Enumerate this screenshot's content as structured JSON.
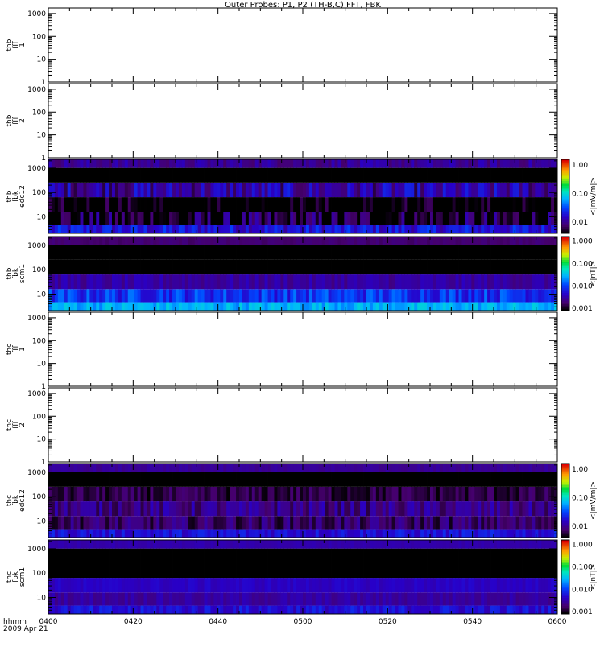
{
  "title": "Outer Probes: P1, P2 (TH-B,C) FFT, FBK",
  "x_axis": {
    "label": "hhmm",
    "date": "2009 Apr 21",
    "ticks": [
      "0400",
      "0420",
      "0440",
      "0500",
      "0520",
      "0540",
      "0600"
    ]
  },
  "chart_data": {
    "type": "heatmap",
    "title": "Outer Probes: P1, P2 (TH-B,C) FFT, FBK",
    "xlabel": "hhmm",
    "xrange_hhmm": [
      "0400",
      "0600"
    ],
    "panels": [
      {
        "label": [
          "thb",
          "fff",
          "1"
        ],
        "kind": "empty",
        "yticks": [
          "1",
          "10",
          "100",
          "1000"
        ],
        "ylim": [
          1,
          1750
        ]
      },
      {
        "label": [
          "thb",
          "fff",
          "2"
        ],
        "kind": "empty",
        "yticks": [
          "1",
          "10",
          "100",
          "1000"
        ],
        "ylim": [
          1,
          1750
        ]
      },
      {
        "label": [
          "thb",
          "fbk",
          "edc12"
        ],
        "kind": "spectrogram",
        "yticks": [
          "10",
          "100",
          "1000"
        ],
        "ylim": [
          2.1,
          2300
        ],
        "band_freqs_hz": [
          2.7,
          8,
          32,
          128,
          512,
          2048
        ],
        "band_median_log10": [
          -1.75,
          -2.35,
          -2.6,
          -1.95,
          -3.0,
          -2.0
        ],
        "band_spread": [
          0.25,
          0.45,
          0.45,
          0.3,
          0.35,
          0.15
        ],
        "colorbar": {
          "ticks": [
            "1.00",
            "0.10",
            "0.01"
          ],
          "unit": "<|mV/m|>",
          "range_log10": [
            -2.4,
            0.2
          ]
        }
      },
      {
        "label": [
          "thb",
          "fbk",
          "scm1"
        ],
        "kind": "spectrogram",
        "yticks": [
          "10",
          "100",
          "1000"
        ],
        "ylim": [
          2.1,
          2300
        ],
        "band_freqs_hz": [
          2.7,
          8,
          32,
          128,
          512,
          2048
        ],
        "band_median_log10": [
          -1.55,
          -2.05,
          -2.55,
          -3.2,
          -3.2,
          -2.75
        ],
        "band_spread": [
          0.2,
          0.3,
          0.15,
          0.08,
          0.08,
          0.06
        ],
        "colorbar": {
          "ticks": [
            "1.000",
            "0.100",
            "0.010",
            "0.001"
          ],
          "unit": "<|nT|>",
          "range_log10": [
            -3.1,
            0.2
          ]
        }
      },
      {
        "label": [
          "thc",
          "fff",
          "1"
        ],
        "kind": "empty",
        "yticks": [
          "1",
          "10",
          "100",
          "1000"
        ],
        "ylim": [
          1,
          1750
        ]
      },
      {
        "label": [
          "thc",
          "fff",
          "2"
        ],
        "kind": "empty",
        "yticks": [
          "1",
          "10",
          "100",
          "1000"
        ],
        "ylim": [
          1,
          1750
        ]
      },
      {
        "label": [
          "thc",
          "fbk",
          "edc12"
        ],
        "kind": "spectrogram",
        "yticks": [
          "10",
          "100",
          "1000"
        ],
        "ylim": [
          2.1,
          2300
        ],
        "band_freqs_hz": [
          2.7,
          8,
          32,
          128,
          512,
          2048
        ],
        "band_median_log10": [
          -1.75,
          -2.15,
          -2.05,
          -2.25,
          -3.0,
          -2.0
        ],
        "band_spread": [
          0.15,
          0.2,
          0.2,
          0.15,
          0.05,
          0.05
        ],
        "colorbar": {
          "ticks": [
            "1.00",
            "0.10",
            "0.01"
          ],
          "unit": "<|mV/m|>",
          "range_log10": [
            -2.4,
            0.2
          ]
        }
      },
      {
        "label": [
          "thc",
          "fbk",
          "scm1"
        ],
        "kind": "spectrogram",
        "yticks": [
          "10",
          "100",
          "1000"
        ],
        "ylim": [
          2.1,
          2300
        ],
        "band_freqs_hz": [
          2.7,
          8,
          32,
          128,
          512,
          2048
        ],
        "band_median_log10": [
          -2.3,
          -2.55,
          -2.4,
          -3.2,
          -3.2,
          -2.5
        ],
        "band_spread": [
          0.2,
          0.12,
          0.08,
          0.06,
          0.06,
          0.04
        ],
        "colorbar": {
          "ticks": [
            "1.000",
            "0.100",
            "0.010",
            "0.001"
          ],
          "unit": "<|nT|>",
          "range_log10": [
            -3.1,
            0.2
          ]
        }
      }
    ]
  }
}
